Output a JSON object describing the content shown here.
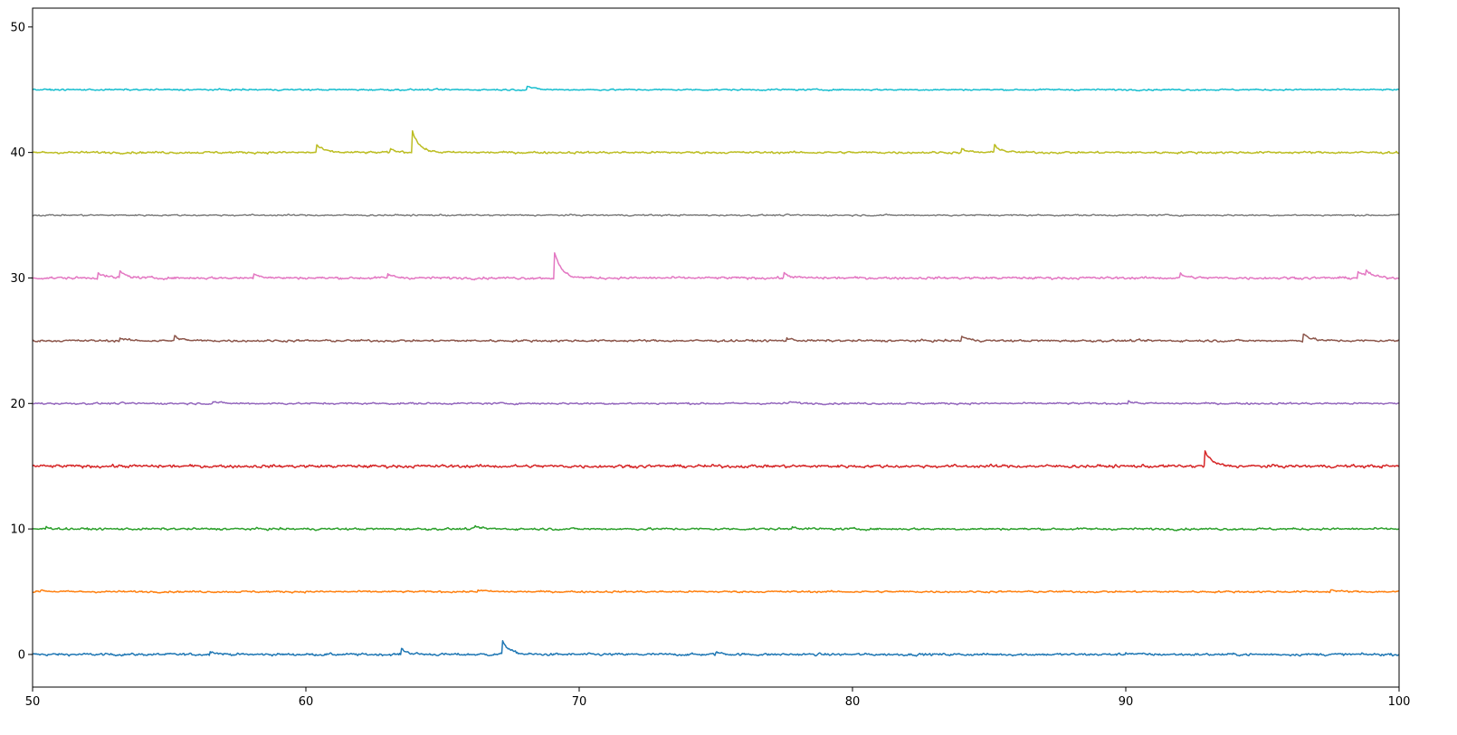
{
  "chart_data": {
    "type": "line",
    "title": "",
    "xlabel": "",
    "ylabel": "",
    "xlim": [
      50,
      100
    ],
    "ylim": [
      -2.6,
      51.5
    ],
    "grid": false,
    "legend": "none",
    "x_ticks": [
      {
        "value": 50,
        "label": "50"
      },
      {
        "value": 60,
        "label": "60"
      },
      {
        "value": 70,
        "label": "70"
      },
      {
        "value": 80,
        "label": "80"
      },
      {
        "value": 90,
        "label": "90"
      },
      {
        "value": 100,
        "label": "100"
      }
    ],
    "y_ticks": [
      {
        "value": 0,
        "label": "0"
      },
      {
        "value": 10,
        "label": "10"
      },
      {
        "value": 20,
        "label": "20"
      },
      {
        "value": 30,
        "label": "30"
      },
      {
        "value": 40,
        "label": "40"
      },
      {
        "value": 50,
        "label": "50"
      }
    ],
    "series": [
      {
        "baseline": 0,
        "color": "#1f77b4",
        "noise": 0.08,
        "events": [
          [
            56.5,
            0.3
          ],
          [
            63.5,
            0.45
          ],
          [
            67.2,
            1.1
          ],
          [
            75.0,
            0.2
          ],
          [
            90.0,
            0.15
          ]
        ]
      },
      {
        "baseline": 5,
        "color": "#ff7f0e",
        "noise": 0.06,
        "events": [
          [
            50.3,
            0.15
          ],
          [
            66.3,
            0.15
          ],
          [
            97.5,
            0.15
          ]
        ]
      },
      {
        "baseline": 10,
        "color": "#2ca02c",
        "noise": 0.07,
        "events": [
          [
            50.5,
            0.15
          ],
          [
            66.2,
            0.2
          ],
          [
            77.8,
            0.2
          ]
        ]
      },
      {
        "baseline": 15,
        "color": "#d62728",
        "noise": 0.1,
        "events": [
          [
            92.9,
            1.2
          ]
        ]
      },
      {
        "baseline": 20,
        "color": "#9467bd",
        "noise": 0.06,
        "events": [
          [
            56.6,
            0.15
          ],
          [
            77.7,
            0.15
          ],
          [
            90.1,
            0.15
          ]
        ]
      },
      {
        "baseline": 25,
        "color": "#8c564b",
        "noise": 0.07,
        "events": [
          [
            53.2,
            0.2
          ],
          [
            55.2,
            0.35
          ],
          [
            77.6,
            0.2
          ],
          [
            84.0,
            0.35
          ],
          [
            96.5,
            0.6
          ]
        ]
      },
      {
        "baseline": 30,
        "color": "#e377c2",
        "noise": 0.08,
        "events": [
          [
            52.4,
            0.45
          ],
          [
            53.2,
            0.5
          ],
          [
            58.1,
            0.4
          ],
          [
            63.0,
            0.3
          ],
          [
            69.1,
            2.0
          ],
          [
            77.5,
            0.35
          ],
          [
            92.0,
            0.3
          ],
          [
            98.5,
            0.55
          ],
          [
            98.8,
            0.45
          ]
        ]
      },
      {
        "baseline": 35,
        "color": "#7f7f7f",
        "noise": 0.05,
        "events": []
      },
      {
        "baseline": 40,
        "color": "#bcbd22",
        "noise": 0.07,
        "events": [
          [
            60.4,
            0.6
          ],
          [
            63.1,
            0.25
          ],
          [
            63.9,
            1.75
          ],
          [
            84.0,
            0.25
          ],
          [
            85.2,
            0.6
          ]
        ]
      },
      {
        "baseline": 45,
        "color": "#17becf",
        "noise": 0.05,
        "events": [
          [
            68.1,
            0.3
          ]
        ]
      }
    ]
  }
}
